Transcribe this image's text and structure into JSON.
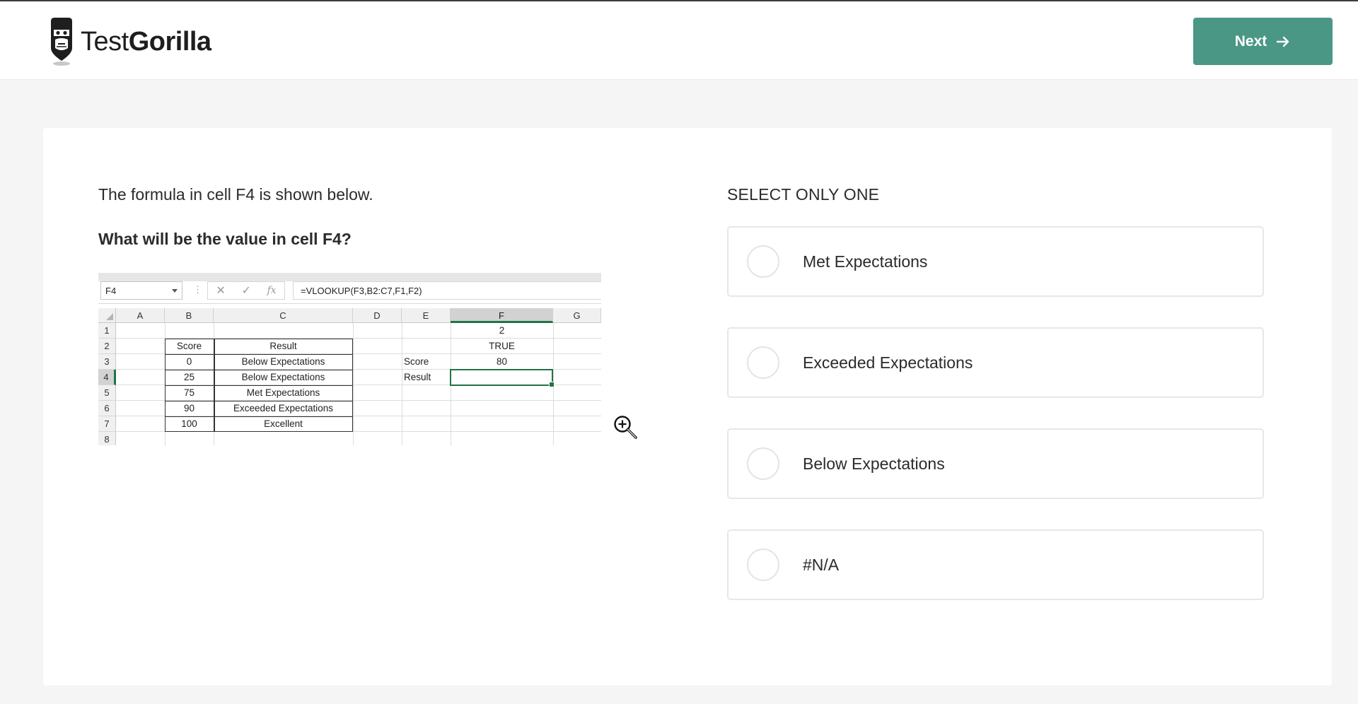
{
  "header": {
    "logo_text_light": "Test",
    "logo_text_bold": "Gorilla",
    "next_label": "Next"
  },
  "question": {
    "intro": "The formula in cell F4 is shown below.",
    "prompt": "What will be the value in cell F4?"
  },
  "spreadsheet": {
    "name_box": "F4",
    "formula": "=VLOOKUP(F3,B2:C7,F1,F2)",
    "columns": [
      "A",
      "B",
      "C",
      "D",
      "E",
      "F",
      "G"
    ],
    "rows": [
      "1",
      "2",
      "3",
      "4",
      "5",
      "6",
      "7",
      "8"
    ],
    "table": {
      "header_score": "Score",
      "header_result": "Result",
      "scores": [
        "0",
        "25",
        "75",
        "90",
        "100"
      ],
      "results": [
        "Below Expectations",
        "Below Expectations",
        "Met Expectations",
        "Exceeded Expectations",
        "Excellent"
      ]
    },
    "e3": "Score",
    "e4": "Result",
    "f1": "2",
    "f2": "TRUE",
    "f3": "80"
  },
  "answers": {
    "instruction": "SELECT ONLY ONE",
    "options": [
      {
        "label": "Met Expectations"
      },
      {
        "label": "Exceeded Expectations"
      },
      {
        "label": "Below Expectations"
      },
      {
        "label": "#N/A"
      }
    ]
  },
  "colors": {
    "accent": "#4a9786",
    "excel_green": "#217346",
    "background": "#f4f5f4"
  },
  "icons": [
    "gorilla-logo-icon",
    "arrow-right-icon",
    "zoom-in-icon",
    "cancel-icon",
    "check-icon",
    "function-icon"
  ]
}
